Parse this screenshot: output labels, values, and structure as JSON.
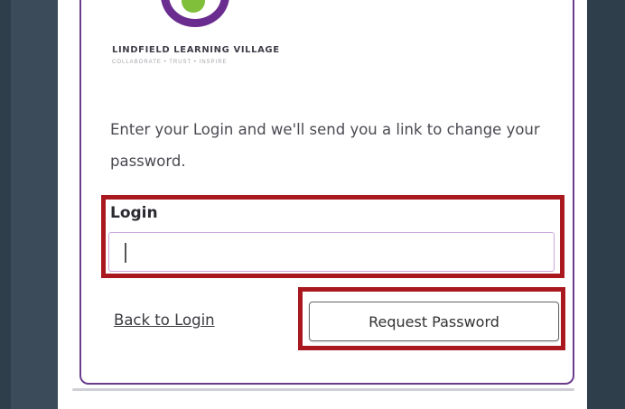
{
  "org": {
    "name": "LINDFIELD LEARNING VILLAGE",
    "tagline": "COLLABORATE  •  TRUST  •  INSPIRE"
  },
  "instructions": "Enter your Login and we'll send you a link to change your password.",
  "form": {
    "login_label": "Login",
    "login_value": "",
    "login_placeholder": ""
  },
  "actions": {
    "back_link": "Back to Login",
    "request_button": "Request Password"
  },
  "colors": {
    "brand_purple": "#6a2d8f",
    "brand_green": "#7fbf3a",
    "highlight_red": "#a8181e",
    "background_dark": "#3b4b59"
  }
}
